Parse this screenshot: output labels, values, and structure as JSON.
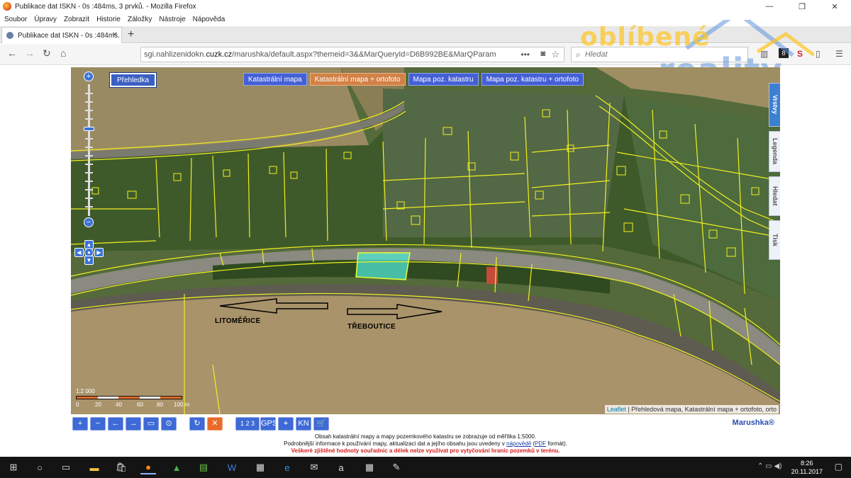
{
  "window": {
    "title": "Publikace dat ISKN - 0s :484ms, 3 prvků. - Mozilla Firefox",
    "minimize": "—",
    "maximize": "❐",
    "close": "✕"
  },
  "menu": [
    "Soubor",
    "Úpravy",
    "Zobrazit",
    "Historie",
    "Záložky",
    "Nástroje",
    "Nápověda"
  ],
  "tab": {
    "label": "Publikace dat ISKN - 0s :484ms.",
    "close": "✕",
    "new_tab": "+"
  },
  "nav": {
    "back": "←",
    "forward": "→",
    "reload": "↻",
    "home": "⌂",
    "url_prefix": "sgi.nahlizenidokn.",
    "url_domain": "cuzk.cz",
    "url_rest": "/marushka/default.aspx?themeid=3&&MarQueryId=D6B992BE&MarQParam",
    "page_actions": "•••",
    "search_placeholder": "Hledat"
  },
  "watermark": {
    "line1": "oblíbené",
    "line2": "reality"
  },
  "map": {
    "overview_button": "Přehledka",
    "layers": [
      {
        "label": "Katastrální mapa",
        "active": false
      },
      {
        "label": "Katastrální mapa + ortofoto",
        "active": true
      },
      {
        "label": "Mapa poz. katastru",
        "active": false
      },
      {
        "label": "Mapa poz. katastru + ortofoto",
        "active": false
      }
    ],
    "zoom_in": "+",
    "zoom_out": "−",
    "labels": {
      "left": "LITOMĚŘICE",
      "right": "TŘEBOUTICE"
    },
    "side_tabs": [
      "Vrstvy",
      "Legenda",
      "Hledat",
      "Tisk"
    ],
    "scale": {
      "ratio": "1:2 000",
      "ticks": [
        "0",
        "20",
        "40",
        "60",
        "80",
        "100 m"
      ]
    },
    "attribution_link": "Leaflet",
    "attribution_text": " | Přehledová mapa, Katastrální mapa + ortofoto, orto"
  },
  "toolbar": {
    "buttons": [
      "+",
      "−",
      "←",
      "→",
      "▭",
      "⊙",
      "↻",
      "✕",
      "1 2 3",
      "GPS",
      "⌖",
      "KN",
      "🛒"
    ],
    "brand": "Marushka®"
  },
  "info": {
    "line1": "Obsah katastrální mapy a mapy pozemkového katastru se zobrazuje od měřítka 1:5000.",
    "line2_a": "Podrobnější informace k používání mapy, aktualizaci dat a jejího obsahu jsou uvedeny v",
    "line2_link": "nápovědě",
    "line2_b": " (",
    "line2_pdf": "PDF",
    "line2_c": " formát).",
    "line3": "Veškeré zjištěné hodnoty souřadnic a délek nelze využívat pro vytyčování hranic pozemků v terénu."
  },
  "taskbar": {
    "time": "8:26",
    "date": "20.11.2017"
  }
}
